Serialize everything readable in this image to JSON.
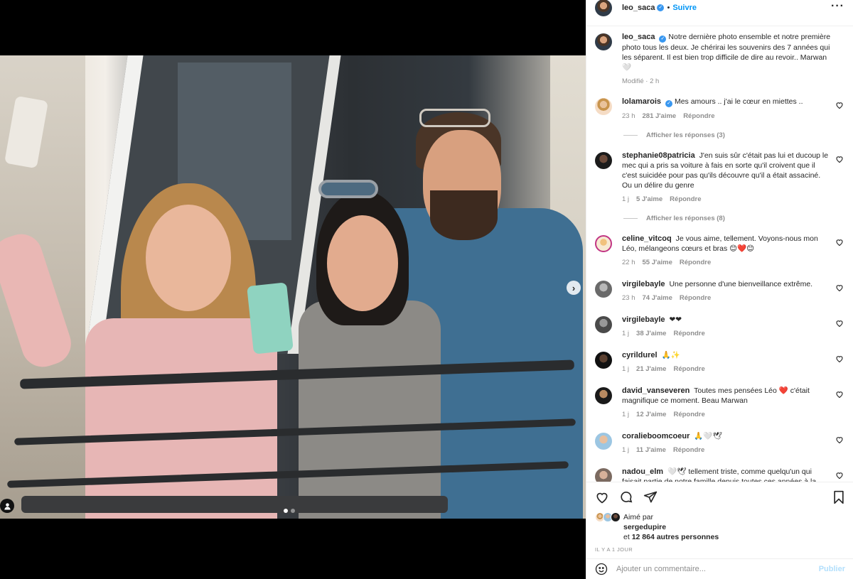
{
  "post": {
    "author": "leo_saca",
    "follow_label": "Suivre",
    "separator": "•",
    "more_label": "···",
    "caption": "Notre dernière photo ensemble et notre première photo tous les deux. Je chérirai les souvenirs des 7 années qui les séparent. Il est bien trop difficile de dire au revoir.. Marwan 🤍",
    "edited": "Modifié · 2 h"
  },
  "media": {
    "carousel_index": 1,
    "carousel_count": 2,
    "next_label": "›"
  },
  "comments": [
    {
      "user": "lolamarois",
      "verified": true,
      "text": "Mes amours .. j'ai le cœur en miettes ..",
      "time": "23 h",
      "likes": "281 J'aime",
      "reply": "Répondre",
      "replies": "Afficher les réponses (3)"
    },
    {
      "user": "stephanie08patricia",
      "verified": false,
      "text": "J'en suis sûr c'était pas lui et ducoup le mec qui a pris sa voiture à fais en sorte qu'il croivent que il c'est suicidée pour pas qu'ils découvre qu'il a était assaciné. Ou un délire du genre",
      "time": "1 j",
      "likes": "5 J'aime",
      "reply": "Répondre",
      "replies": "Afficher les réponses (8)"
    },
    {
      "user": "celine_vitcoq",
      "verified": false,
      "text": "Je vous aime, tellement. Voyons-nous mon Léo, mélangeons cœurs et bras 😊❤️😊",
      "time": "22 h",
      "likes": "55 J'aime",
      "reply": "Répondre",
      "replies": ""
    },
    {
      "user": "virgilebayle",
      "verified": false,
      "text": "Une personne d'une bienveillance extrême.",
      "time": "23 h",
      "likes": "74 J'aime",
      "reply": "Répondre",
      "replies": ""
    },
    {
      "user": "virgilebayle",
      "verified": false,
      "text": "❤❤",
      "time": "1 j",
      "likes": "38 J'aime",
      "reply": "Répondre",
      "replies": ""
    },
    {
      "user": "cyrildurel",
      "verified": false,
      "text": "🙏✨",
      "time": "1 j",
      "likes": "21 J'aime",
      "reply": "Répondre",
      "replies": ""
    },
    {
      "user": "david_vanseveren",
      "verified": false,
      "text": "Toutes mes pensées Léo ❤️ c'était magnifique ce moment. Beau Marwan",
      "time": "1 j",
      "likes": "12 J'aime",
      "reply": "Répondre",
      "replies": ""
    },
    {
      "user": "coralieboomcoeur",
      "verified": false,
      "text": "🙏🤍🕊",
      "time": "1 j",
      "likes": "11 J'aime",
      "reply": "Répondre",
      "replies": ""
    },
    {
      "user": "nadou_elm",
      "verified": false,
      "text": "🤍🕊 tellement triste, comme quelqu'un qui faisait partie de notre famille depuis toutes ces années à la",
      "time": "",
      "likes": "",
      "reply": "",
      "replies": ""
    }
  ],
  "likes": {
    "prefix": "Aimé par",
    "first_user": "sergedupire",
    "and_label": "et",
    "others": "12 864 autres personnes"
  },
  "time_ago": "IL Y A 1 JOUR",
  "add_comment": {
    "placeholder": "Ajouter un commentaire...",
    "publish_label": "Publier"
  },
  "icons": {
    "like": "heart-icon",
    "comment": "comment-icon",
    "share": "share-icon",
    "save": "bookmark-icon",
    "emoji": "emoji-icon",
    "user_tag": "user-tag-icon"
  },
  "colors": {
    "link": "#0095f6",
    "verified": "#3897f0",
    "muted": "#8e8e8e",
    "publish_disabled": "#b2dffc"
  }
}
